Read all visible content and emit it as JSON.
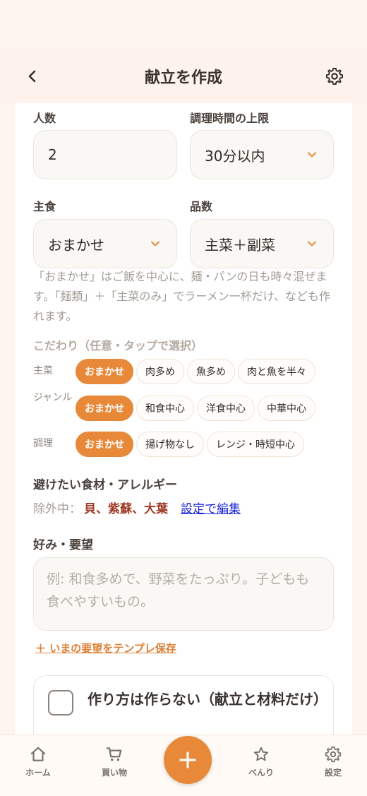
{
  "header": {
    "title": "献立を作成"
  },
  "form": {
    "people_label": "人数",
    "people_value": "2",
    "time_label": "調理時間の上限",
    "time_value": "30分以内",
    "staple_label": "主食",
    "staple_value": "おまかせ",
    "dishes_label": "品数",
    "dishes_value": "主菜＋副菜",
    "note": "「おまかせ」はご飯を中心に、麺・パンの日も時々混ぜます。「麺類」＋「主菜のみ」でラーメン一杯だけ、なども作れます。"
  },
  "preferences": {
    "title": "こだわり（任意・タップで選択）",
    "rows": [
      {
        "label": "主菜",
        "chips": [
          "おまかせ",
          "肉多め",
          "魚多め",
          "肉と魚を半々"
        ],
        "selected": 0
      },
      {
        "label": "ジャンル",
        "chips": [
          "おまかせ",
          "和食中心",
          "洋食中心",
          "中華中心"
        ],
        "selected": 0
      },
      {
        "label": "調理",
        "chips": [
          "おまかせ",
          "揚げ物なし",
          "レンジ・時短中心"
        ],
        "selected": 0
      }
    ]
  },
  "allergy": {
    "title": "避けたい食材・アレルギー",
    "prefix": "除外中：",
    "items": "貝、紫蘇、大葉",
    "edit_link": "設定で編集"
  },
  "requests": {
    "title": "好み・要望",
    "placeholder": "例: 和食多めで、野菜をたっぷり。子どもも食べやすいもの。",
    "save_template": "＋ いまの要望をテンプレ保存"
  },
  "option": {
    "no_recipe_label": "作り方は作らない（献立と材料だけ）",
    "checked": false
  },
  "tabbar": {
    "home": "ホーム",
    "shopping": "買い物",
    "favorites": "べんり",
    "settings": "設定"
  },
  "colors": {
    "accent": "#e8893a",
    "excluded": "#a13c29",
    "link": "#1a25d6",
    "background": "#fdf5ef"
  }
}
